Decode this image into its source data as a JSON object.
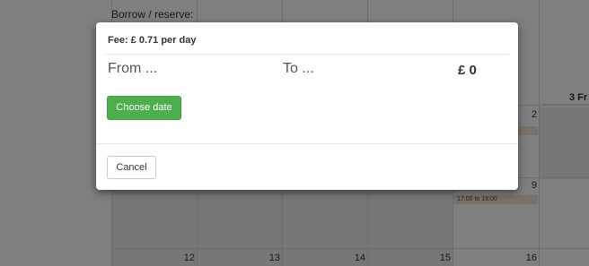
{
  "page": {
    "borrow_label": "Borrow / reserve:"
  },
  "calendar": {
    "header_day": "3 Fr",
    "week_row_top": [
      "2",
      "9"
    ],
    "week_row_bottom": [
      "12",
      "13",
      "14",
      "15",
      "16"
    ],
    "booking": "17:00 to 19:00"
  },
  "modal": {
    "fee": "Fee: £ 0.71 per day",
    "from_placeholder": "From ...",
    "to_placeholder": "To ...",
    "total": "£ 0",
    "choose_date_label": "Choose date",
    "cancel_label": "Cancel"
  },
  "colors": {
    "choose_button": "#4cae4c",
    "booking_highlight": "#f4e2d0"
  }
}
